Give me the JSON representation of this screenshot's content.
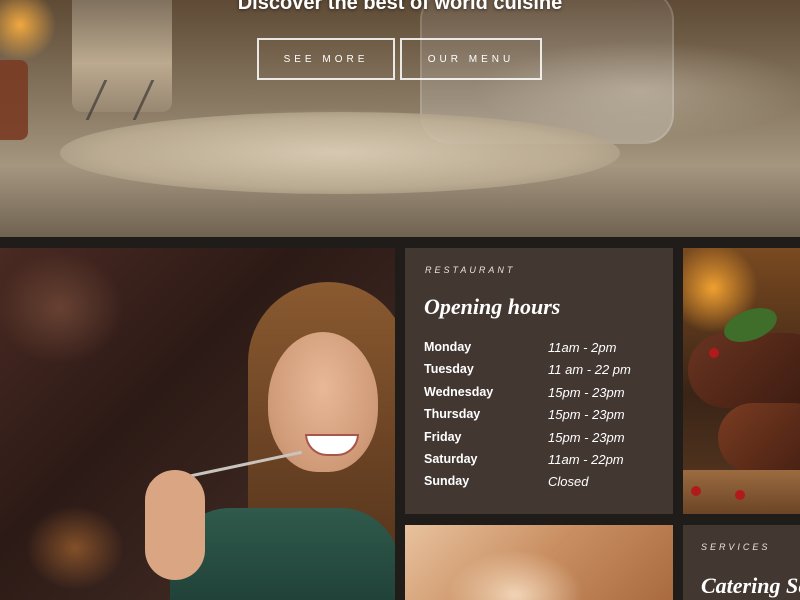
{
  "hero": {
    "title": "Discover the best of world cuisine",
    "buttons": {
      "see_more": "SEE MORE",
      "our_menu": "OUR MENU"
    }
  },
  "hours": {
    "eyebrow": "RESTAURANT",
    "title": "Opening hours",
    "rows": [
      {
        "day": "Monday",
        "time": "11am - 2pm"
      },
      {
        "day": "Tuesday",
        "time": "11 am - 22 pm"
      },
      {
        "day": "Wednesday",
        "time": "15pm - 23pm"
      },
      {
        "day": "Thursday",
        "time": "15pm - 23pm"
      },
      {
        "day": "Friday",
        "time": "15pm - 23pm"
      },
      {
        "day": "Saturday",
        "time": "11am - 22pm"
      },
      {
        "day": "Sunday",
        "time": "Closed"
      }
    ]
  },
  "services": {
    "eyebrow": "SERVICES",
    "title": "Catering Se"
  },
  "colors": {
    "card_bg": "#433732",
    "page_bg": "#1f1c1a",
    "text": "#ffffff"
  }
}
